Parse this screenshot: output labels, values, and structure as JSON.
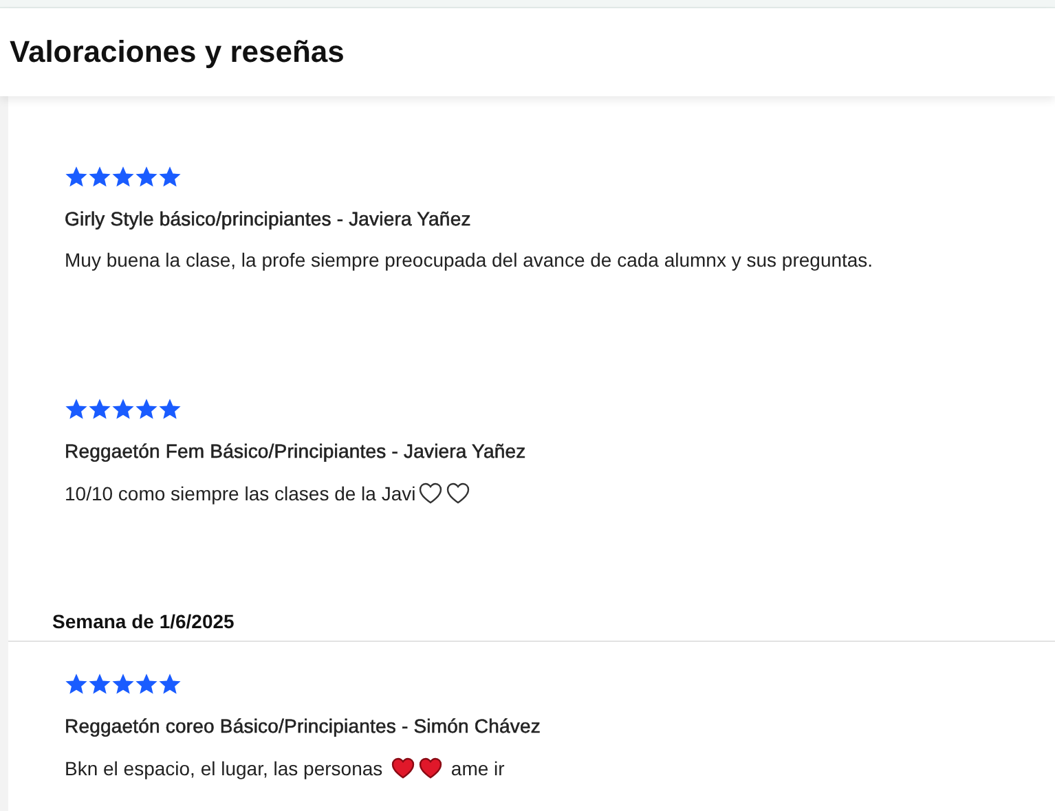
{
  "header": {
    "title": "Valoraciones y reseñas"
  },
  "sections": [
    {
      "reviews": [
        {
          "stars": 5,
          "title": "Girly Style básico/principiantes - Javiera Yañez",
          "comment": [
            {
              "kind": "text",
              "text": "Muy buena la clase, la profe siempre preocupada del avance de cada alumnx y sus preguntas."
            }
          ]
        },
        {
          "stars": 5,
          "title": "Reggaetón Fem Básico/Principiantes - Javiera Yañez",
          "comment": [
            {
              "kind": "text",
              "text": "10/10 como siempre las clases de la Javi"
            },
            {
              "kind": "heart",
              "filled": false
            },
            {
              "kind": "heart",
              "filled": false
            }
          ]
        }
      ]
    },
    {
      "week": "Semana de 1/6/2025",
      "reviews": [
        {
          "stars": 5,
          "title": "Reggaetón coreo Básico/Principiantes - Simón Chávez",
          "comment": [
            {
              "kind": "text",
              "text": "Bkn el espacio, el lugar, las personas "
            },
            {
              "kind": "heart",
              "filled": true
            },
            {
              "kind": "heart",
              "filled": true
            },
            {
              "kind": "text",
              "text": " ame ir"
            }
          ]
        }
      ]
    }
  ]
}
